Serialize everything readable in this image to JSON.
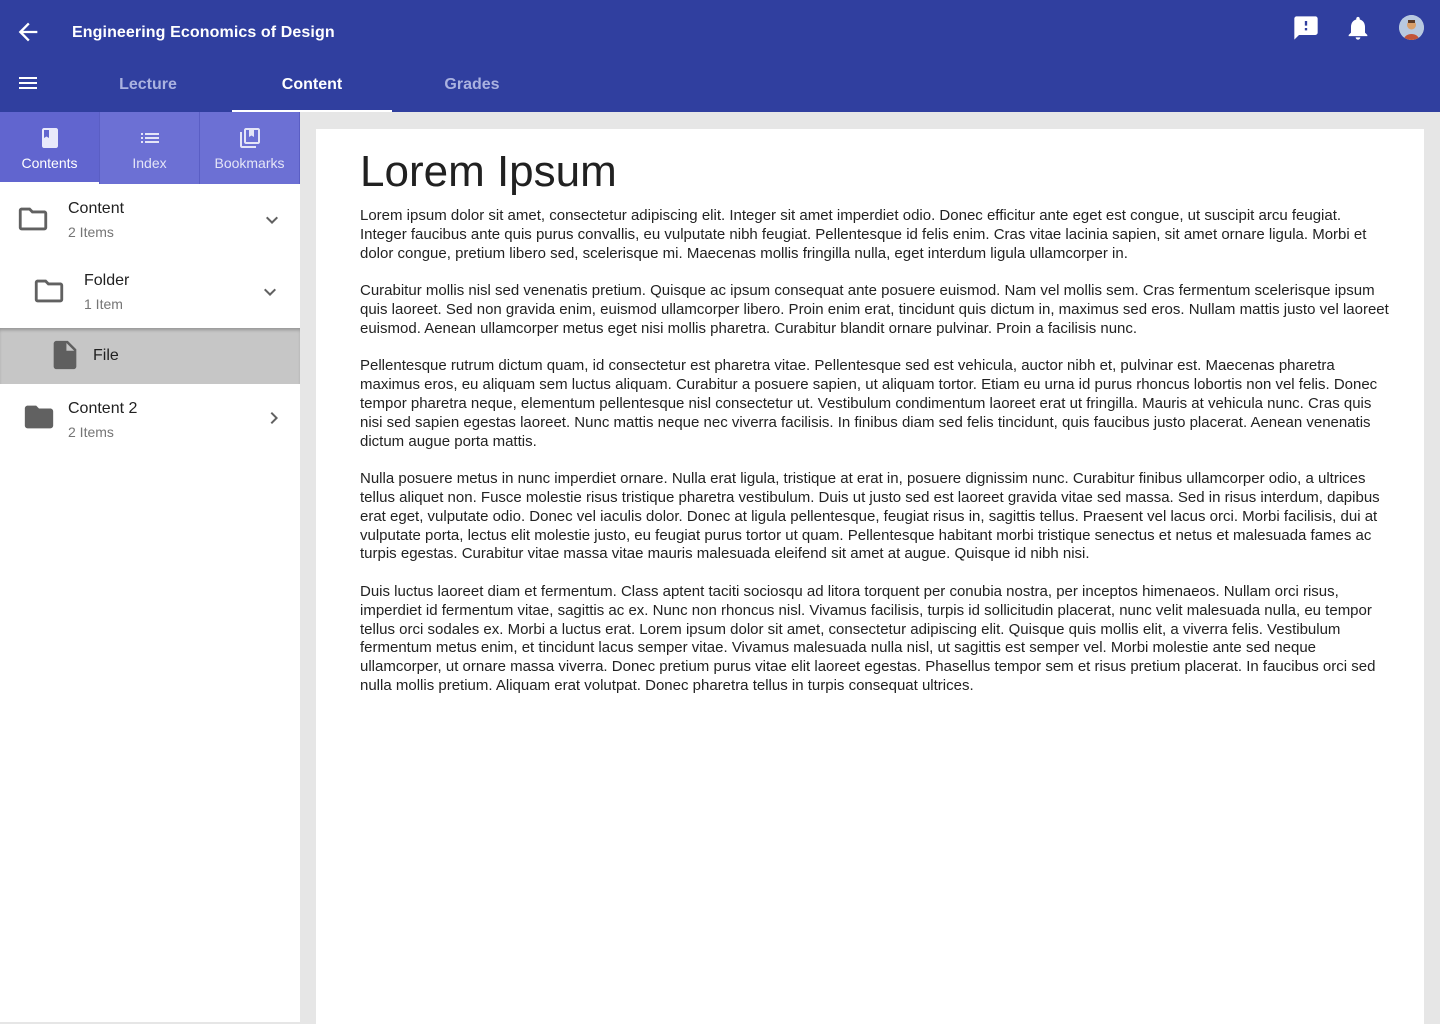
{
  "app": {
    "title": "Engineering Economics of Design",
    "accent_color": "#303f9f",
    "icons": {
      "back": "arrow-left-icon",
      "feedback": "feedback-icon",
      "notifications": "bell-icon",
      "menu": "hamburger-menu-icon",
      "account": "avatar"
    }
  },
  "tabs": [
    {
      "label": "Lecture",
      "active": false
    },
    {
      "label": "Content",
      "active": true
    },
    {
      "label": "Grades",
      "active": false
    }
  ],
  "sidebar": {
    "tabs": [
      {
        "label": "Contents",
        "icon": "book-icon",
        "active": true
      },
      {
        "label": "Index",
        "icon": "list-icon",
        "active": false
      },
      {
        "label": "Bookmarks",
        "icon": "bookmarks-icon",
        "active": false
      }
    ],
    "tree": [
      {
        "title": "Content",
        "subtitle": "2 Items",
        "icon": "folder-outline-icon",
        "expanded": true
      },
      {
        "title": "Folder",
        "subtitle": "1 Item",
        "icon": "folder-outline-icon",
        "expanded": true
      },
      {
        "title": "File",
        "icon": "file-icon",
        "selected": true
      },
      {
        "title": "Content 2",
        "subtitle": "2 Items",
        "icon": "folder-icon",
        "expanded": false
      }
    ]
  },
  "document": {
    "title": "Lorem Ipsum",
    "paragraphs": [
      "Lorem ipsum dolor sit amet, consectetur adipiscing elit. Integer sit amet imperdiet odio. Donec efficitur ante eget est congue, ut suscipit arcu feugiat. Integer faucibus ante quis purus convallis, eu vulputate nibh feugiat. Pellentesque id felis enim. Cras vitae lacinia sapien, sit amet ornare ligula. Morbi et dolor congue, pretium libero sed, scelerisque mi. Maecenas mollis fringilla nulla, eget interdum ligula ullamcorper in.",
      "Curabitur mollis nisl sed venenatis pretium. Quisque ac ipsum consequat ante posuere euismod. Nam vel mollis sem. Cras fermentum scelerisque ipsum quis laoreet. Sed non gravida enim, euismod ullamcorper libero. Proin enim erat, tincidunt quis dictum in, maximus sed eros. Nullam mattis justo vel laoreet euismod. Aenean ullamcorper metus eget nisi mollis pharetra. Curabitur blandit ornare pulvinar. Proin a facilisis nunc.",
      "Pellentesque rutrum dictum quam, id consectetur est pharetra vitae. Pellentesque sed est vehicula, auctor nibh et, pulvinar est. Maecenas pharetra maximus eros, eu aliquam sem luctus aliquam. Curabitur a posuere sapien, ut aliquam tortor. Etiam eu urna id purus rhoncus lobortis non vel felis. Donec tempor pharetra neque, elementum pellentesque nisl consectetur ut. Vestibulum condimentum laoreet erat ut fringilla. Mauris at vehicula nunc. Cras quis nisi sed sapien egestas laoreet. Nunc mattis neque nec viverra facilisis. In finibus diam sed felis tincidunt, quis faucibus justo placerat. Aenean venenatis dictum augue porta mattis.",
      "Nulla posuere metus in nunc imperdiet ornare. Nulla erat ligula, tristique at erat in, posuere dignissim nunc. Curabitur finibus ullamcorper odio, a ultrices tellus aliquet non. Fusce molestie risus tristique pharetra vestibulum. Duis ut justo sed est laoreet gravida vitae sed massa. Sed in risus interdum, dapibus erat eget, vulputate odio. Donec vel iaculis dolor. Donec at ligula pellentesque, feugiat risus in, sagittis tellus. Praesent vel lacus orci. Morbi facilisis, dui at vulputate porta, lectus elit molestie justo, eu feugiat purus tortor ut quam. Pellentesque habitant morbi tristique senectus et netus et malesuada fames ac turpis egestas. Curabitur vitae massa vitae mauris malesuada eleifend sit amet at augue. Quisque id nibh nisi.",
      "Duis luctus laoreet diam et fermentum. Class aptent taciti sociosqu ad litora torquent per conubia nostra, per inceptos himenaeos. Nullam orci risus, imperdiet id fermentum vitae, sagittis ac ex. Nunc non rhoncus nisl. Vivamus facilisis, turpis id sollicitudin placerat, nunc velit malesuada nulla, eu tempor tellus orci sodales ex. Morbi a luctus erat. Lorem ipsum dolor sit amet, consectetur adipiscing elit. Quisque quis mollis elit, a viverra felis. Vestibulum fermentum metus enim, et tincidunt lacus semper vitae. Vivamus malesuada nulla nisl, ut sagittis est semper vel. Morbi molestie ante sed neque ullamcorper, ut ornare massa viverra. Donec pretium purus vitae elit laoreet egestas. Phasellus tempor sem et risus pretium placerat. In faucibus orci sed nulla mollis pretium. Aliquam erat volutpat. Donec pharetra tellus in turpis consequat ultrices."
    ]
  }
}
